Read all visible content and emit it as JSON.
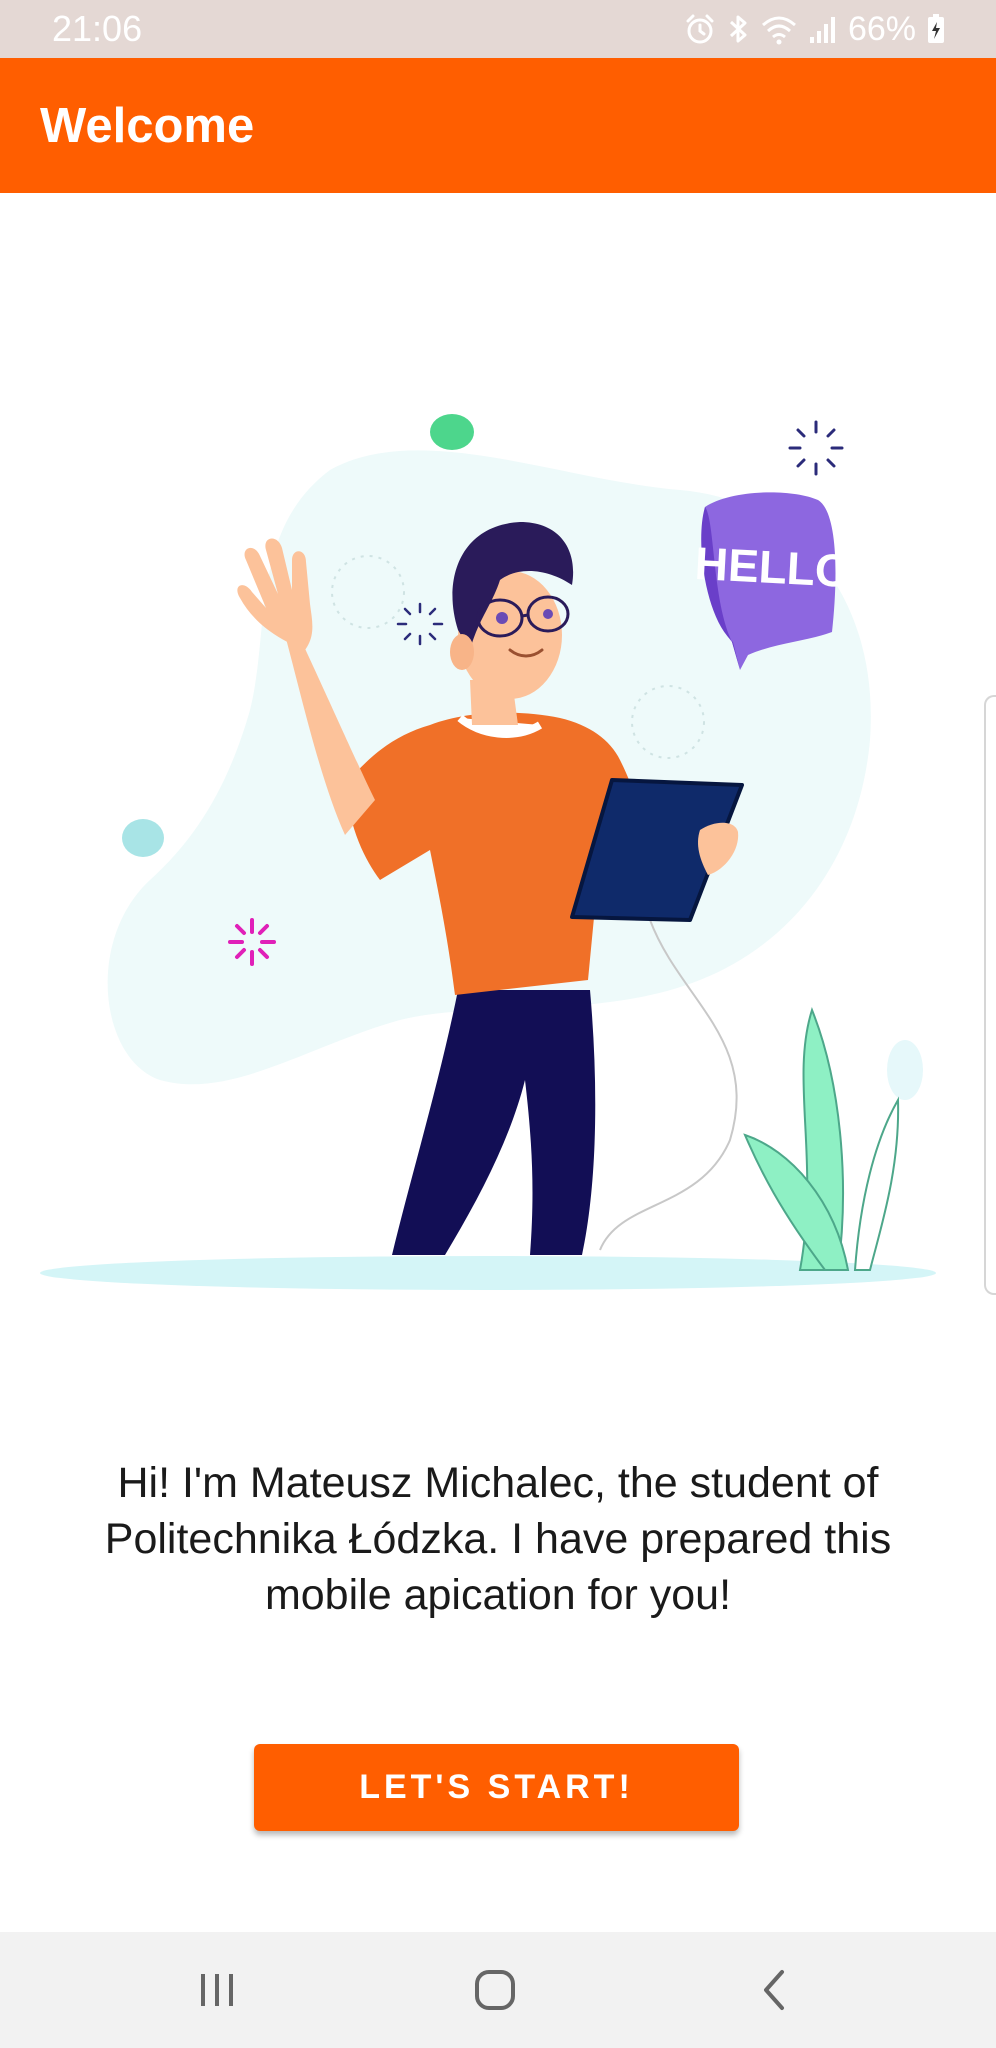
{
  "status_bar": {
    "time": "21:06",
    "battery": "66%",
    "icons": [
      "alarm-icon",
      "bluetooth-icon",
      "wifi-icon",
      "signal-icon",
      "battery-icon"
    ]
  },
  "app_bar": {
    "title": "Welcome"
  },
  "illustration": {
    "speech_bubble_text": "HELLO"
  },
  "main": {
    "message": "Hi! I'm Mateusz Michalec, the student of Politechnika Łódzka. I have prepared this mobile apication for you!",
    "start_button_label": "LET'S START!"
  },
  "nav_bar": {
    "icons": [
      "recent-apps-icon",
      "home-icon",
      "back-icon"
    ]
  },
  "colors": {
    "accent": "#ff5e00",
    "status_bar": "#e4d8d4",
    "nav_bar": "#f2f2f2"
  }
}
